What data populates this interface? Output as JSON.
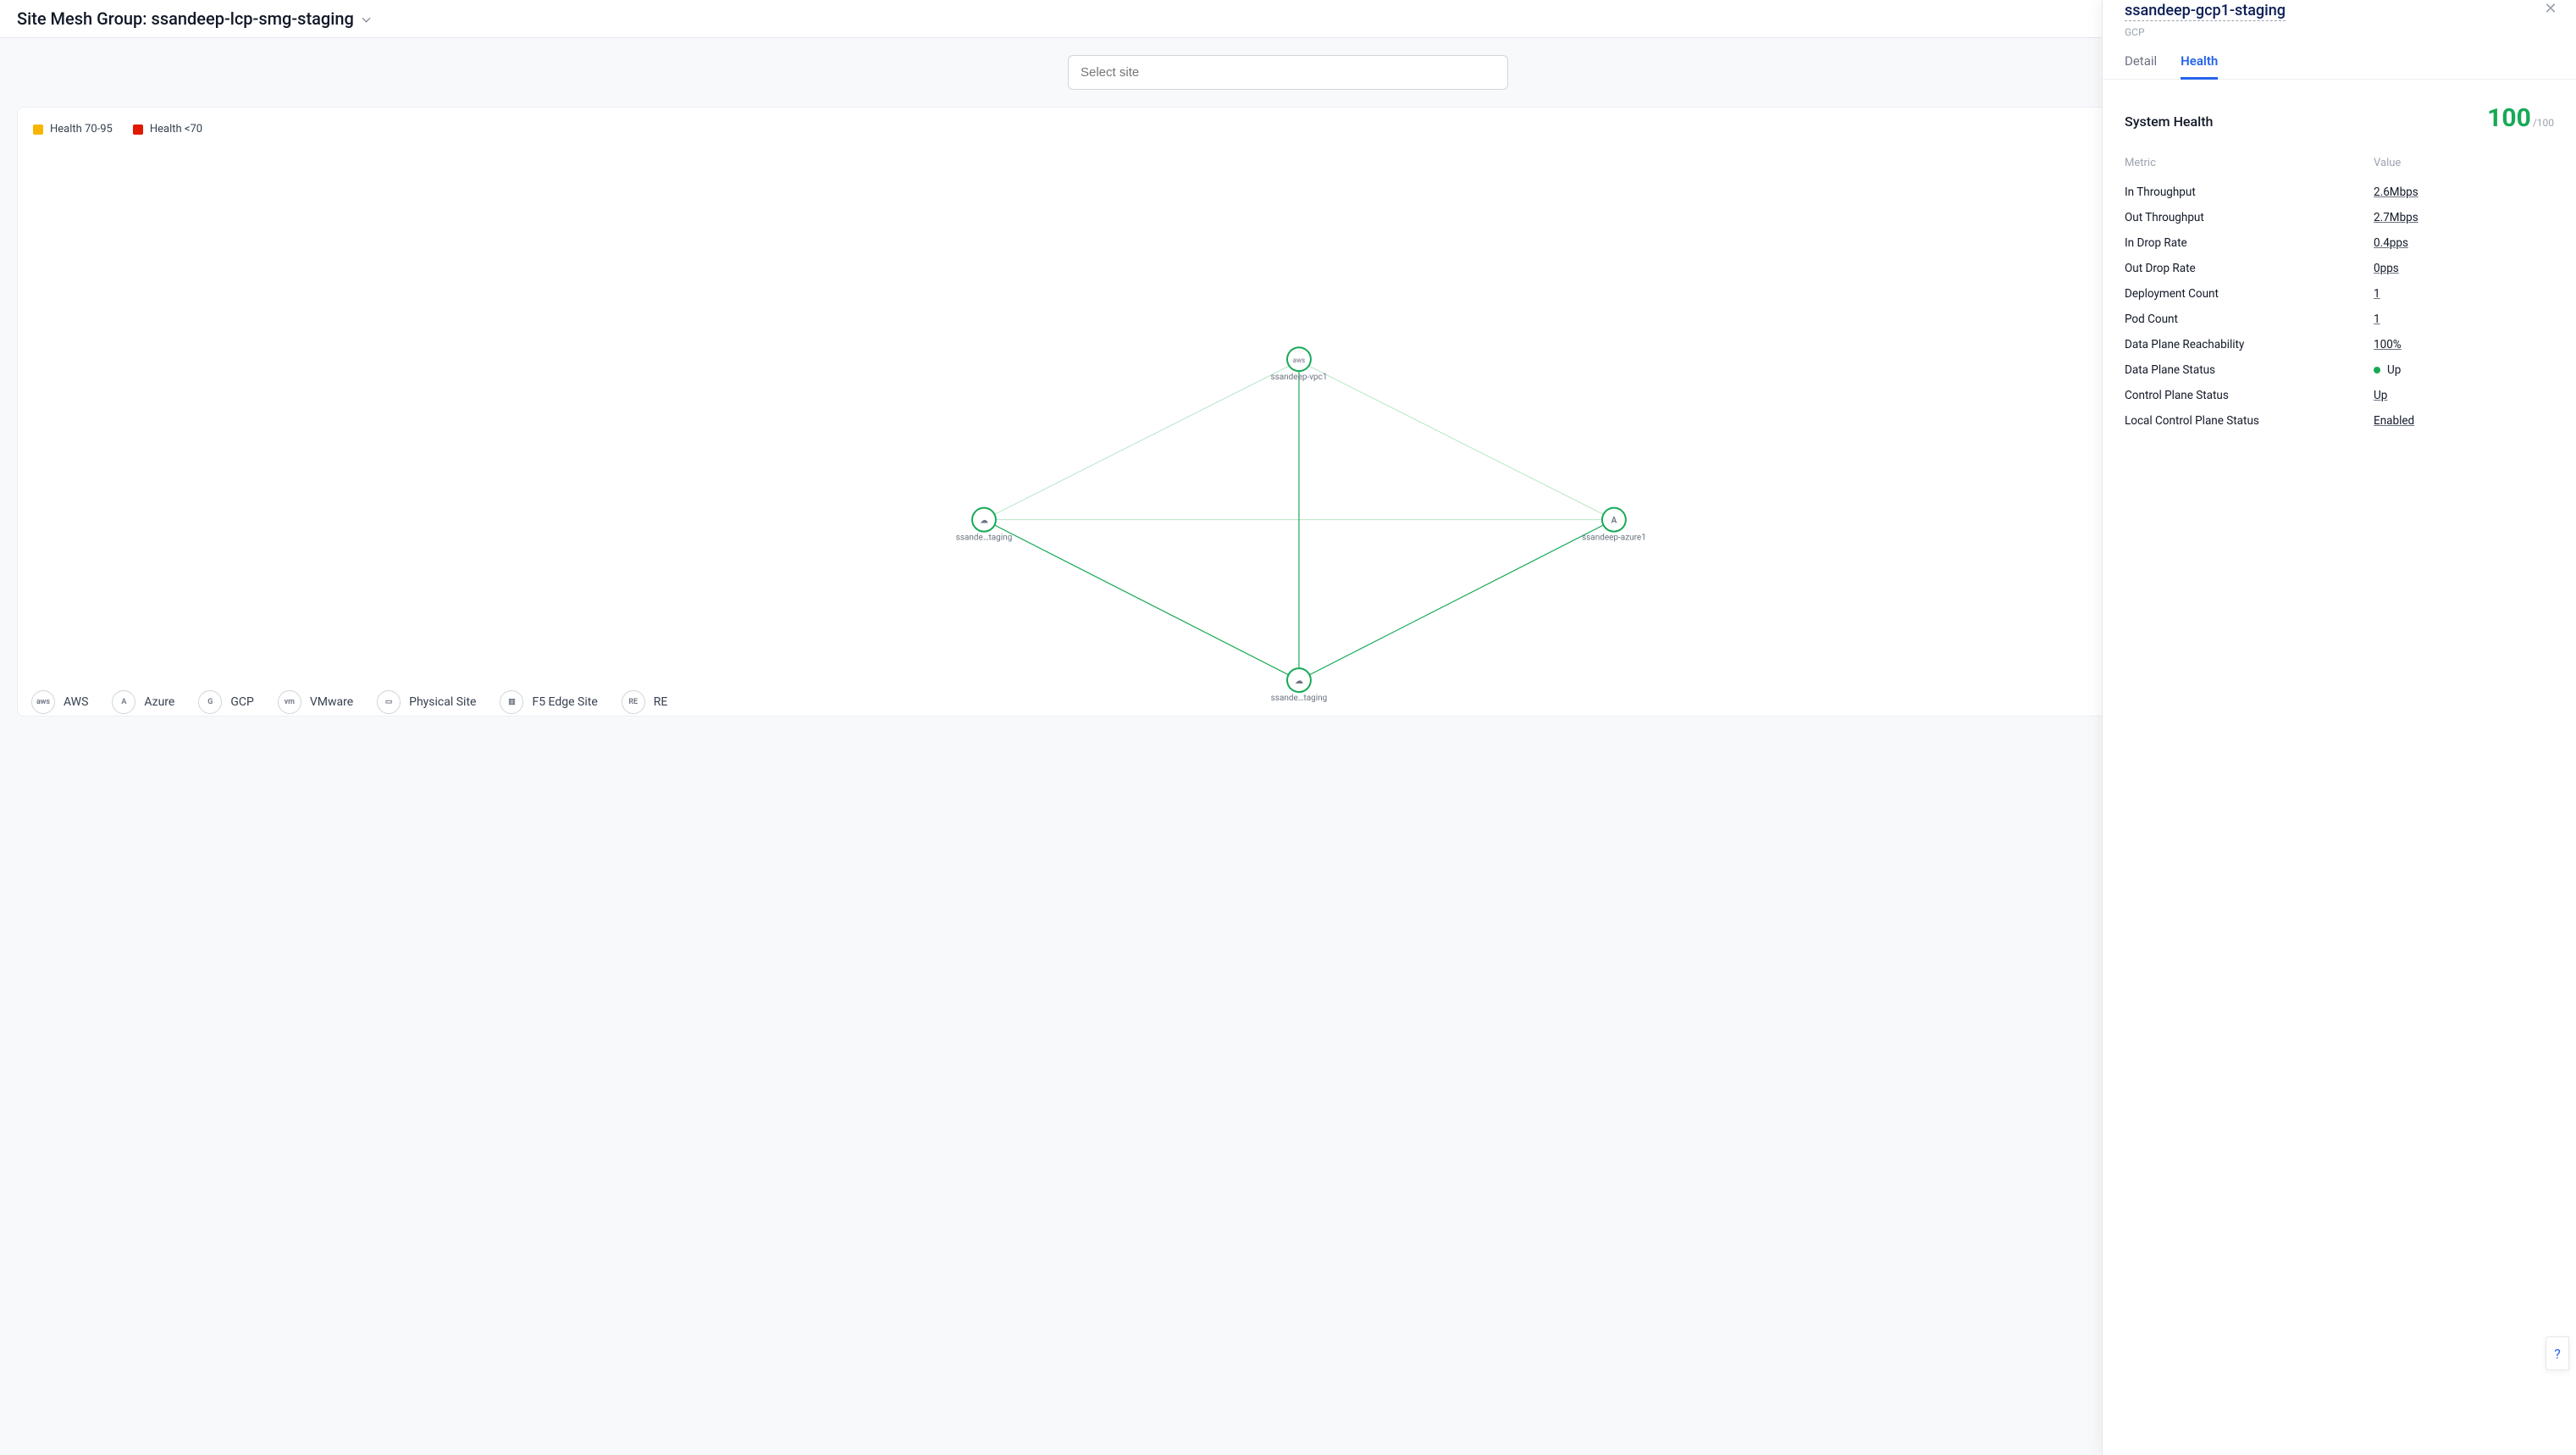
{
  "header": {
    "title": "Site Mesh Group: ssandeep-lcp-smg-staging"
  },
  "search": {
    "placeholder": "Select site"
  },
  "legend": {
    "mid": "Health 70-95",
    "low": "Health <70"
  },
  "graph": {
    "nodes": {
      "top": {
        "label": "ssandeep-vpc1",
        "icon": "aws"
      },
      "left": {
        "label": "ssande…taging",
        "icon": "cloud"
      },
      "right": {
        "label": "ssandeep-azure1",
        "icon": "A"
      },
      "bottom": {
        "label": "ssande…taging",
        "icon": "cloud"
      }
    }
  },
  "providers": [
    {
      "icon": "aws",
      "label": "AWS"
    },
    {
      "icon": "A",
      "label": "Azure"
    },
    {
      "icon": "G",
      "label": "GCP"
    },
    {
      "icon": "vm",
      "label": "VMware"
    },
    {
      "icon": "▭",
      "label": "Physical Site"
    },
    {
      "icon": "▥",
      "label": "F5 Edge Site"
    },
    {
      "icon": "RE",
      "label": "RE"
    }
  ],
  "panel": {
    "title": "ssandeep-gcp1-staging",
    "subtitle": "GCP",
    "tabs": {
      "detail": "Detail",
      "health": "Health"
    },
    "system_health_label": "System Health",
    "score": "100",
    "score_denom": "/100",
    "metrics_header": {
      "metric": "Metric",
      "value": "Value"
    },
    "metrics": [
      {
        "name": "In Throughput",
        "value": "2.6Mbps",
        "link": true
      },
      {
        "name": "Out Throughput",
        "value": "2.7Mbps",
        "link": true
      },
      {
        "name": "In Drop Rate",
        "value": "0.4pps",
        "link": true
      },
      {
        "name": "Out Drop Rate",
        "value": "0pps",
        "link": true
      },
      {
        "name": "Deployment Count",
        "value": "1",
        "link": true
      },
      {
        "name": "Pod Count",
        "value": "1",
        "link": true
      },
      {
        "name": "Data Plane Reachability",
        "value": "100%",
        "link": true
      },
      {
        "name": "Data Plane Status",
        "value": "Up",
        "link": false,
        "dot": true
      },
      {
        "name": "Control Plane Status",
        "value": "Up",
        "link": true
      },
      {
        "name": "Local Control Plane Status",
        "value": "Enabled",
        "link": true
      }
    ]
  }
}
